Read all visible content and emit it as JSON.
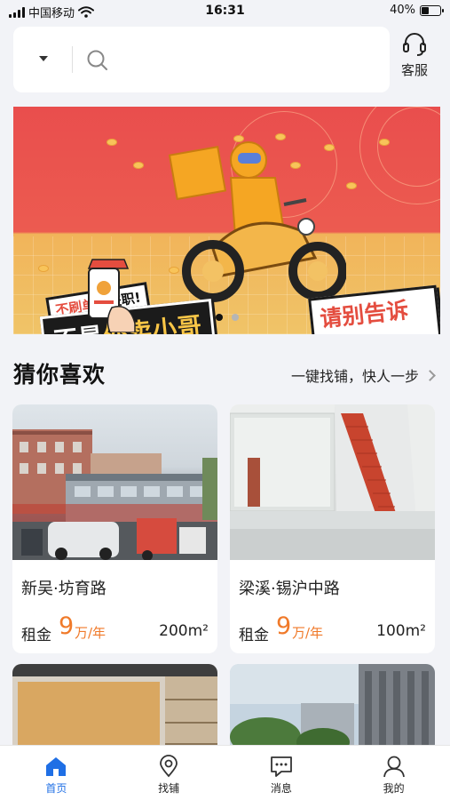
{
  "status_bar": {
    "carrier": "中国移动",
    "time": "16:31",
    "battery": "40%",
    "battery_level": 0.4
  },
  "search": {
    "dropdown_icon": "caret-down-icon",
    "search_icon": "search-icon"
  },
  "service": {
    "label": "客服",
    "icon": "headset-icon"
  },
  "banner": {
    "tag_small_red": "不刷单的",
    "tag_small_black": "兼职!",
    "tag_big_white": "不是",
    "tag_big_yellow": "外卖小哥",
    "tag_right": "请别告诉他",
    "slide_count": 2,
    "active_slide": 1
  },
  "section": {
    "title": "猜你喜欢",
    "link": "一键找铺，快人一步"
  },
  "listings": [
    {
      "title": "新吴·坊育路",
      "rent_label": "租金",
      "price": "9",
      "unit": "万/年",
      "area": "200m²"
    },
    {
      "title": "梁溪·锡沪中路",
      "rent_label": "租金",
      "price": "9",
      "unit": "万/年",
      "area": "100m²"
    }
  ],
  "tabbar": {
    "items": [
      {
        "label": "首页",
        "icon": "home-icon",
        "active": true
      },
      {
        "label": "找铺",
        "icon": "location-pin-icon",
        "active": false
      },
      {
        "label": "消息",
        "icon": "message-icon",
        "active": false
      },
      {
        "label": "我的",
        "icon": "user-icon",
        "active": false
      }
    ]
  },
  "colors": {
    "accent": "#1f6fe5",
    "price": "#f07a2a",
    "banner_red": "#e94e4d"
  }
}
